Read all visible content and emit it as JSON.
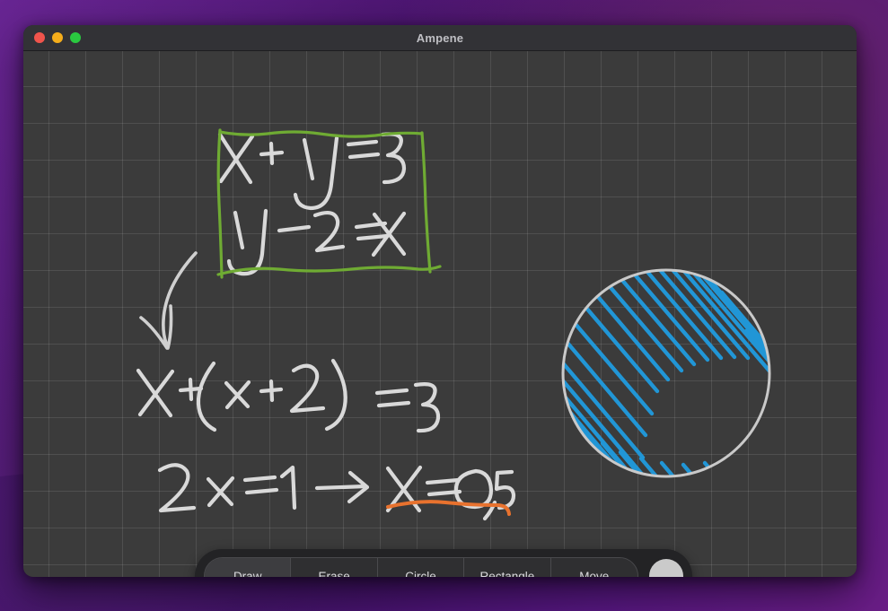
{
  "window": {
    "title": "Ampene",
    "controls": [
      {
        "name": "close",
        "color": "#f0544c"
      },
      {
        "name": "minimize",
        "color": "#f5ad1b"
      },
      {
        "name": "maximize",
        "color": "#2ac940"
      }
    ]
  },
  "canvas": {
    "background_color": "#3b3b3b",
    "grid_color": "rgba(255,255,255,0.10)",
    "grid_spacing": 41,
    "annotations": [
      {
        "id": "boxed-equation-1",
        "text": "x + y = 3",
        "ink_color": "#d9d9d9",
        "kind": "handwriting"
      },
      {
        "id": "boxed-equation-2",
        "text": "y - 2 = x",
        "ink_color": "#d9d9d9",
        "kind": "handwriting"
      },
      {
        "id": "highlight-box",
        "text": "",
        "ink_color": "#6fab33",
        "kind": "rectangle"
      },
      {
        "id": "curved-arrow",
        "text": "",
        "ink_color": "#d9d9d9",
        "kind": "arrow"
      },
      {
        "id": "equation-3",
        "text": "x + (x + 2) = 3",
        "ink_color": "#d9d9d9",
        "kind": "handwriting"
      },
      {
        "id": "equation-4",
        "text": "2 x = 1 → x = 0,5",
        "ink_color": "#d9d9d9",
        "kind": "handwriting"
      },
      {
        "id": "result-underline",
        "text": "",
        "ink_color": "#e8722e",
        "kind": "underline"
      },
      {
        "id": "shaded-circle",
        "text": "",
        "ink_color": "#c9c9c9",
        "fill_color": "#2196d6",
        "kind": "circle-scribble"
      }
    ]
  },
  "toolbar": {
    "tools": [
      {
        "label": "Draw",
        "active": true
      },
      {
        "label": "Erase",
        "active": false
      },
      {
        "label": "Circle",
        "active": false
      },
      {
        "label": "Rectangle",
        "active": false
      },
      {
        "label": "Move",
        "active": false
      }
    ],
    "color_swatch": "#cacaca"
  }
}
